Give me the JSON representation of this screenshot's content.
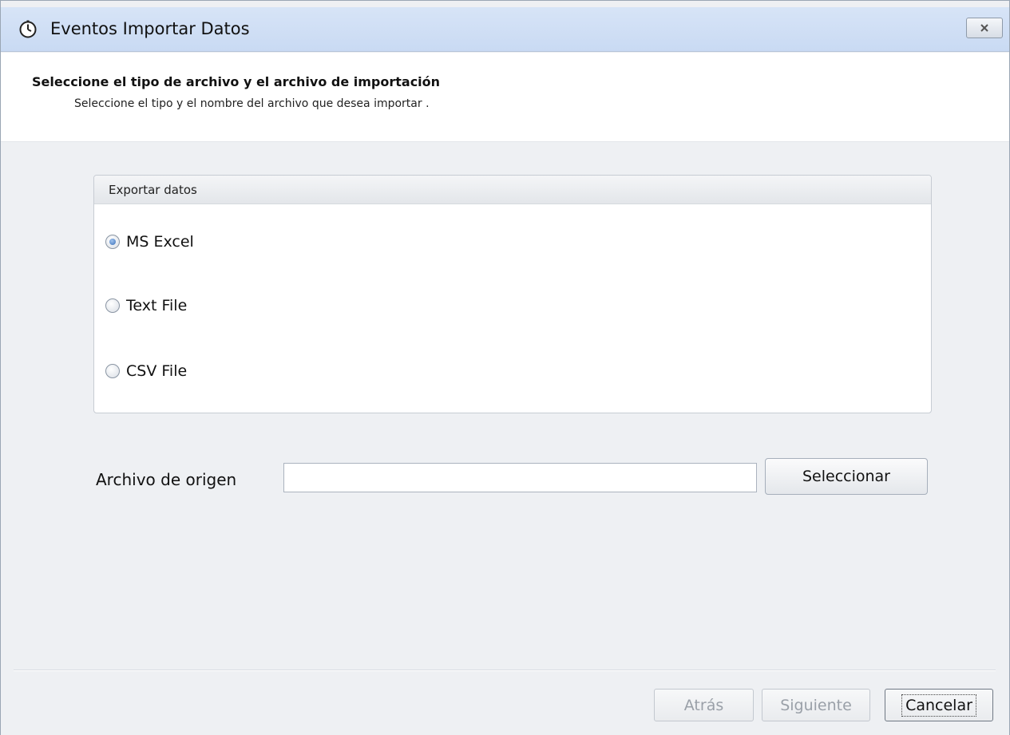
{
  "window": {
    "title": "Eventos Importar Datos",
    "title_icon": "clock-icon",
    "close_icon": "close-icon"
  },
  "header": {
    "title": "Seleccione el tipo de archivo y el archivo de importación",
    "subtitle": "Seleccione el tipo y el nombre del archivo que desea importar ."
  },
  "export_group": {
    "label": "Exportar datos",
    "options": [
      {
        "label": "MS Excel",
        "checked": true
      },
      {
        "label": "Text File",
        "checked": false
      },
      {
        "label": "CSV File",
        "checked": false
      }
    ]
  },
  "source": {
    "label": "Archivo de origen",
    "value": "",
    "select_label": "Seleccionar"
  },
  "footer": {
    "back_label": "Atrás",
    "next_label": "Siguiente",
    "cancel_label": "Cancelar"
  }
}
